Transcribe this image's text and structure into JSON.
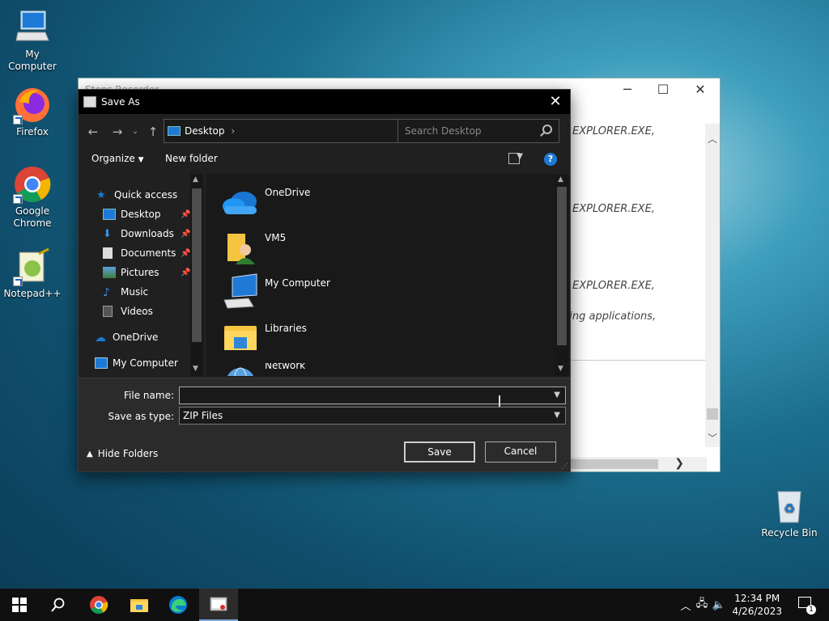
{
  "desktop": {
    "icons": [
      {
        "label": "My Computer"
      },
      {
        "label": "Firefox"
      },
      {
        "label": "Google Chrome"
      },
      {
        "label": "Notepad++"
      },
      {
        "label": "Recycle Bin"
      }
    ]
  },
  "background_window": {
    "title": "Steps Recorder",
    "lines": [
      "EXPLORER.EXE,",
      "EXPLORER.EXE,",
      "EXPLORER.EXE,",
      "ning applications,"
    ]
  },
  "dialog": {
    "title": "Save As",
    "address": "Desktop",
    "search_placeholder": "Search Desktop",
    "toolbar": {
      "organize": "Organize",
      "new_folder": "New folder",
      "help": "?"
    },
    "nav": [
      {
        "label": "Quick access"
      },
      {
        "label": "Desktop"
      },
      {
        "label": "Downloads"
      },
      {
        "label": "Documents"
      },
      {
        "label": "Pictures"
      },
      {
        "label": "Music"
      },
      {
        "label": "Videos"
      },
      {
        "label": "OneDrive"
      },
      {
        "label": "My Computer"
      }
    ],
    "files": [
      {
        "name": "OneDrive"
      },
      {
        "name": "VM5"
      },
      {
        "name": "My Computer"
      },
      {
        "name": "Libraries"
      },
      {
        "name": "Network"
      }
    ],
    "file_name_label": "File name:",
    "file_name_value": "",
    "save_type_label": "Save as type:",
    "save_type_value": "ZIP Files",
    "hide_folders": "Hide Folders",
    "save": "Save",
    "cancel": "Cancel"
  },
  "taskbar": {
    "time": "12:34 PM",
    "date": "4/26/2023",
    "notifications": "1"
  },
  "colors": {
    "accent": "#1e7ad6",
    "dialog_bg": "#202020",
    "taskbar_bg": "#101010"
  }
}
